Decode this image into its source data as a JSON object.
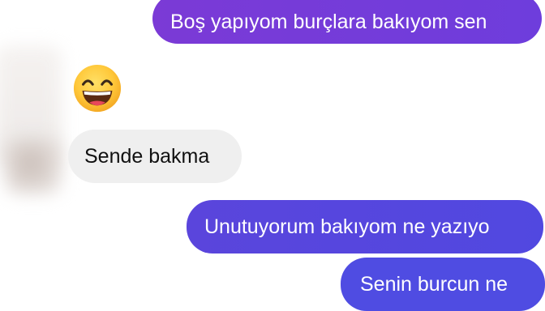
{
  "messages": [
    {
      "direction": "outgoing",
      "text": "Boş yapıyom burçlara bakıyom sen"
    },
    {
      "direction": "incoming",
      "emoji": "grinning-face-with-smiling-eyes"
    },
    {
      "direction": "incoming",
      "text": "Sende bakma"
    },
    {
      "direction": "outgoing",
      "text": "Unutuyorum bakıyom ne yazıyo"
    },
    {
      "direction": "outgoing",
      "text": "Senin burcun ne"
    }
  ],
  "colors": {
    "outgoing_top": "#7b3ad6",
    "outgoing_mid": "#5a45dc",
    "outgoing_bottom": "#4f4ce2",
    "incoming_bubble": "#efefef",
    "background": "#ffffff"
  }
}
